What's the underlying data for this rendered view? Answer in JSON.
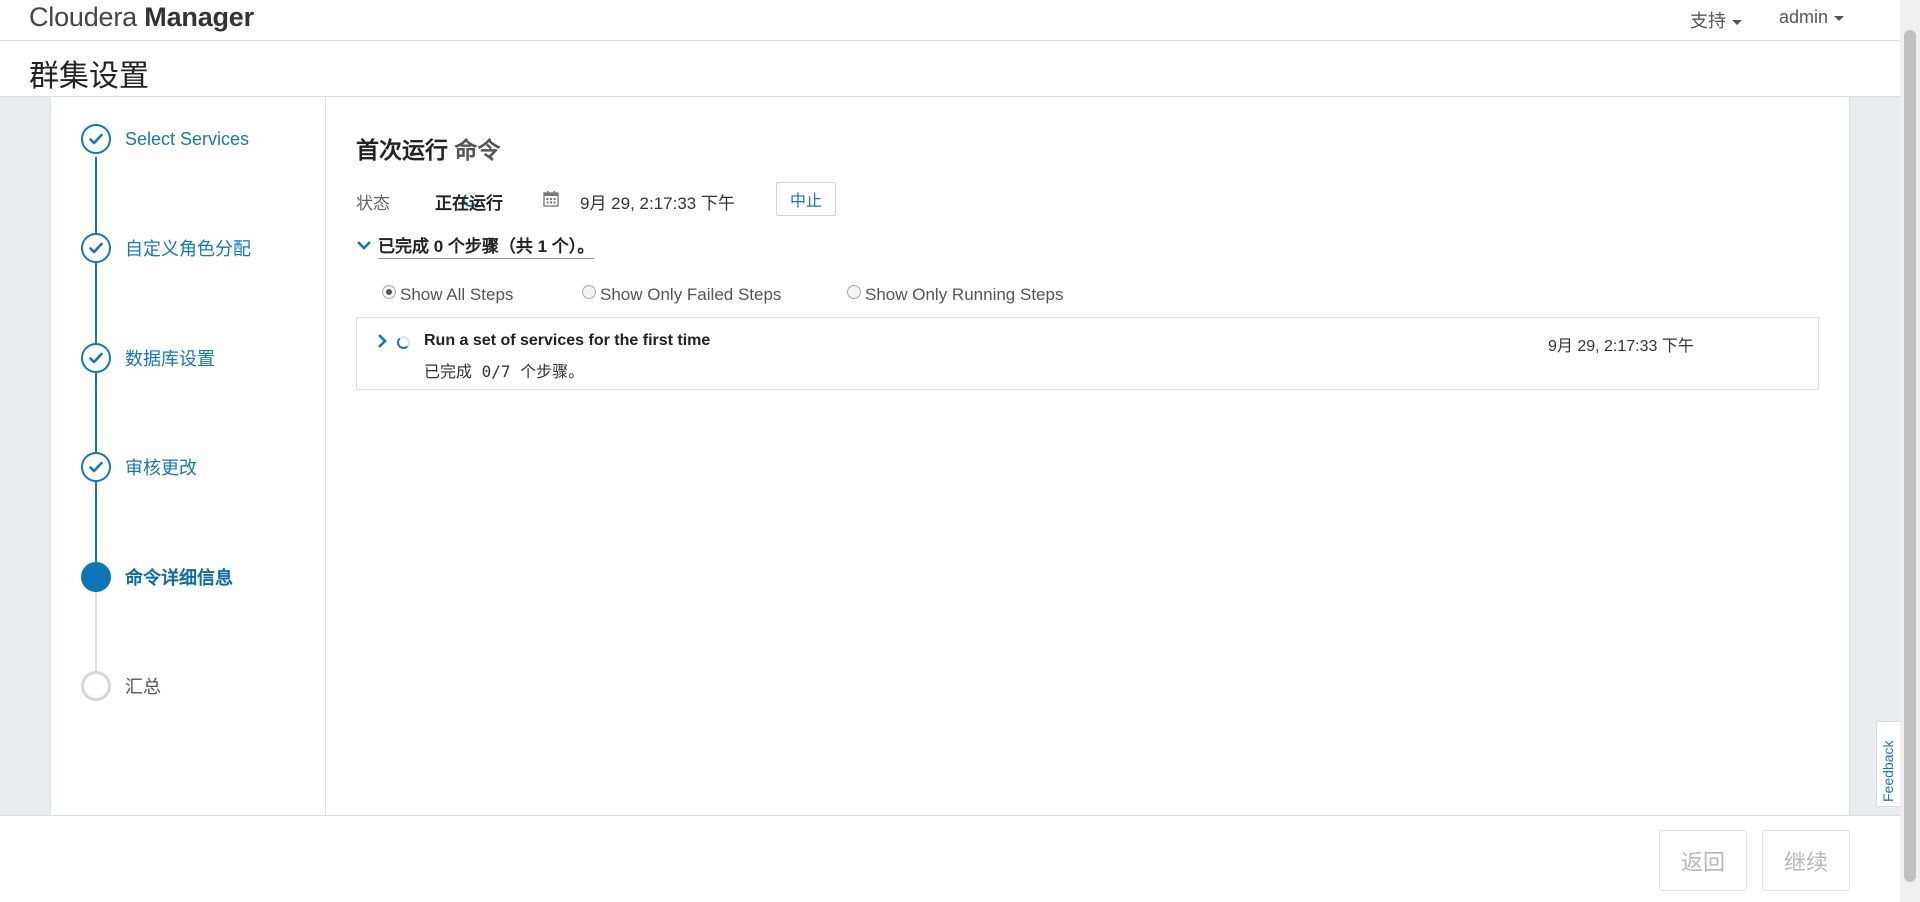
{
  "app": {
    "brand_light": "Cloudera",
    "brand_bold": "Manager"
  },
  "nav": {
    "support": "支持",
    "user": "admin"
  },
  "page": {
    "title": "群集设置"
  },
  "wizard_steps": [
    {
      "label": "Select Services",
      "state": "done"
    },
    {
      "label": "自定义角色分配",
      "state": "done"
    },
    {
      "label": "数据库设置",
      "state": "done"
    },
    {
      "label": "审核更改",
      "state": "done"
    },
    {
      "label": "命令详细信息",
      "state": "active"
    },
    {
      "label": "汇总",
      "state": "pending"
    }
  ],
  "command": {
    "title_main": "首次运行",
    "title_suffix": "命令",
    "status_label": "状态",
    "status_value": "正在运行",
    "start_time": "9月 29, 2:17:33 下午",
    "abort_label": "中止",
    "steps_summary": "已完成 0 个步骤（共 1 个）。",
    "filters": [
      {
        "label": "Show All Steps",
        "selected": true
      },
      {
        "label": "Show Only Failed Steps",
        "selected": false
      },
      {
        "label": "Show Only Running Steps",
        "selected": false
      }
    ],
    "step_rows": [
      {
        "name": "Run a set of services for the first time",
        "time": "9月 29, 2:17:33 下午",
        "progress": "已完成 0/7 个步骤。"
      }
    ]
  },
  "footer": {
    "back_label": "返回",
    "continue_label": "继续"
  },
  "feedback": {
    "label": "Feedback"
  },
  "colors": {
    "accent": "#1777b4",
    "active_step": "#0d75b5",
    "disabled_text": "#b5b9bd"
  }
}
